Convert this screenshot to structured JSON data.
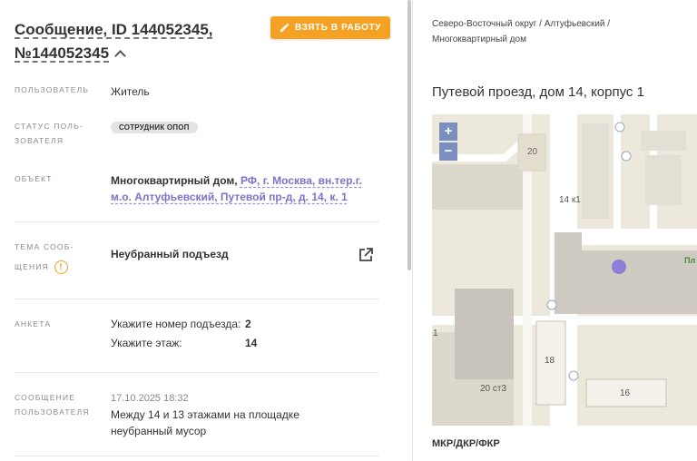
{
  "header": {
    "title": "Сообщение, ID 144052345, №144052345",
    "take_button": "ВЗЯТЬ В РАБОТУ"
  },
  "fields": {
    "user_label": "ПОЛЬЗОВАТЕЛЬ",
    "user_value": "Житель",
    "status_label_1": "СТАТУС ПОЛЬ-",
    "status_label_2": "ЗОВАТЕЛЯ",
    "status_value": "СОТРУДНИК ОПОП",
    "object_label": "ОБЪЕКТ",
    "object_type": "Многоквартирный дом,",
    "object_address": "РФ, г. Москва, вн.тер.г. м.о. Алтуфьевский, Путевой пр-д, д. 14, к. 1",
    "topic_label_1": "ТЕМА СООБ-",
    "topic_label_2": "ЩЕНИЯ",
    "topic_value": "Неубранный подъезд",
    "survey_label": "АНКЕТА",
    "survey": [
      {
        "question": "Укажите номер подъезда:",
        "answer": "2"
      },
      {
        "question": "Укажите этаж:",
        "answer": "14"
      }
    ],
    "message_label_1": "СООБЩЕНИЕ",
    "message_label_2": "ПОЛЬЗОВАТЕЛЯ",
    "message_date": "17.10.2025 18:32",
    "message_text": "Между 14 и 13 этажами на площадке неубранный мусор"
  },
  "right": {
    "breadcrumb": "Северо-Восточный округ / Алтуфьевский / Многоквартирный дом",
    "address": "Путевой проезд, дом 14, корпус 1",
    "map_labels": {
      "b20": "20",
      "b14k1": "14 к1",
      "b18": "18",
      "b16": "16",
      "b20s3": "20 ст3",
      "b1": "1",
      "pl": "Пл"
    },
    "zoom_in": "+",
    "zoom_out": "−",
    "footer_label": "МКР/ДКР/ФКР"
  },
  "colors": {
    "accent": "#f5a123",
    "link": "#7c72c9",
    "marker": "#8a7fd6"
  }
}
